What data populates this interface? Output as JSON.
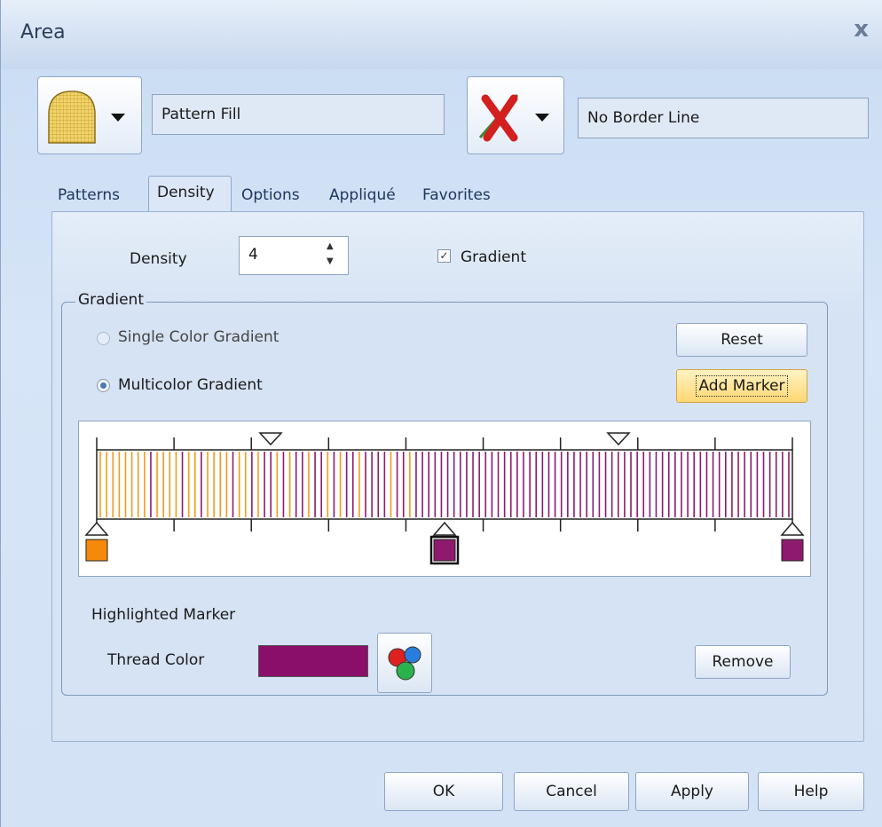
{
  "window": {
    "title": "Area",
    "close_glyph": "x"
  },
  "fill": {
    "type_value": "Pattern Fill",
    "icon": "pattern-fill-icon",
    "fill_color": "#f2d36b"
  },
  "border": {
    "type_value": "No Border Line",
    "icon": "no-border-icon",
    "x_color": "#d41f1f"
  },
  "tabs": {
    "items": [
      "Patterns",
      "Density",
      "Options",
      "Appliqué",
      "Favorites"
    ],
    "active": "Density"
  },
  "density": {
    "label": "Density",
    "value": "4"
  },
  "gradient_checkbox": {
    "label": "Gradient",
    "checked": true,
    "mark": "✓"
  },
  "gradient_group": {
    "title": "Gradient",
    "single_color_label": "Single Color Gradient",
    "multicolor_label": "Multicolor Gradient",
    "selected": "Multicolor Gradient",
    "reset_label": "Reset",
    "add_marker_label": "Add Marker"
  },
  "gradient_editor": {
    "stripe_color_1": "#f59a1a",
    "stripe_color_2": "#8e1a6f",
    "markers": [
      {
        "position": 0.0,
        "color": "#f58a0a"
      },
      {
        "position": 0.5,
        "color": "#8e1a6f",
        "selected": true
      },
      {
        "position": 1.0,
        "color": "#8e1a6f"
      }
    ],
    "mid_handles": [
      0.25,
      0.75
    ],
    "tick_count": 10
  },
  "highlighted": {
    "heading": "Highlighted Marker",
    "thread_label": "Thread Color",
    "thread_color": "#8a0f6a",
    "color_picker_icon": "thread-palette-icon",
    "remove_label": "Remove"
  },
  "footer": {
    "ok": "OK",
    "cancel": "Cancel",
    "apply": "Apply",
    "help": "Help"
  }
}
